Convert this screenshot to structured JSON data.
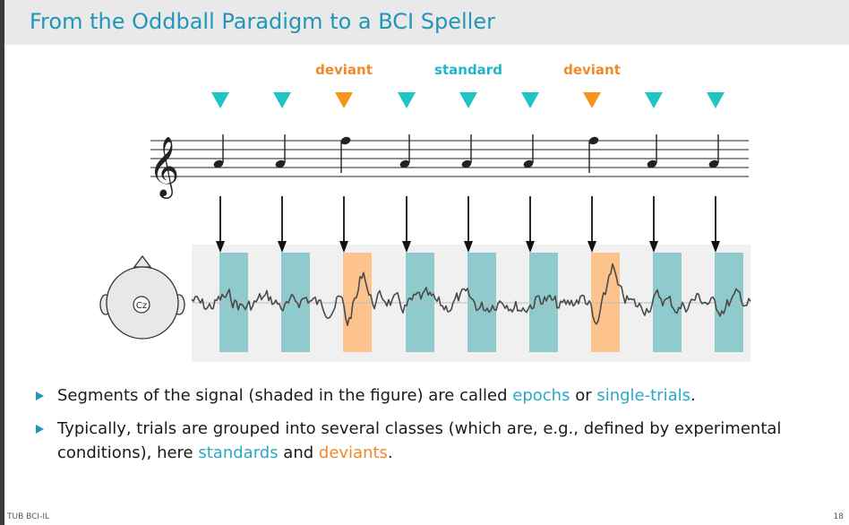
{
  "slide": {
    "title": "From the Oddball Paradigm to a BCI Speller",
    "footer_left": "TUB BCI-IL",
    "page_number": "18"
  },
  "figure": {
    "labels": {
      "deviant": "deviant",
      "standard": "standard"
    },
    "electrode_label": "Cz",
    "stimuli": [
      "standard",
      "standard",
      "deviant",
      "standard",
      "standard",
      "standard",
      "deviant",
      "standard",
      "standard"
    ],
    "colors": {
      "standard_marker": "#1fc4c4",
      "deviant_marker": "#f7941d",
      "standard_epoch": "#8fcacc",
      "deviant_epoch": "#fcc48c",
      "standard_label": "#1fb6c8",
      "deviant_label": "#f08a28",
      "signal": "#4a4a4a",
      "signal_panel": "#f0f0f0"
    }
  },
  "bullets": [
    {
      "parts": [
        {
          "text": "Segments of the signal (shaded in the figure) are called ",
          "style": "normal"
        },
        {
          "text": "epochs",
          "style": "blue"
        },
        {
          "text": " or ",
          "style": "normal"
        },
        {
          "text": "single-trials",
          "style": "blue"
        },
        {
          "text": ".",
          "style": "normal"
        }
      ]
    },
    {
      "parts": [
        {
          "text": "Typically, trials are grouped into several classes (which are, e.g., defined by experimental conditions), here ",
          "style": "normal"
        },
        {
          "text": "standards",
          "style": "blue"
        },
        {
          "text": " and ",
          "style": "normal"
        },
        {
          "text": "deviants",
          "style": "orange"
        },
        {
          "text": ".",
          "style": "normal"
        }
      ]
    }
  ]
}
